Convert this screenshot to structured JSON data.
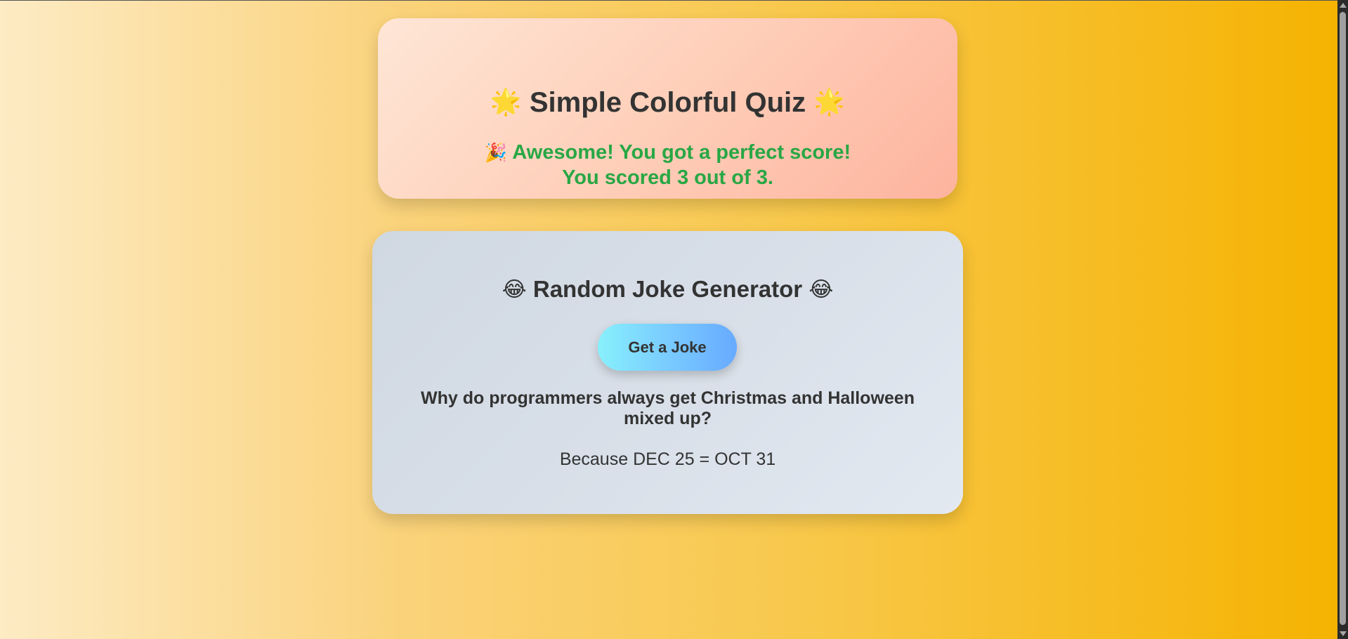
{
  "quiz": {
    "title_emoji_left": "🌟",
    "title": "Simple Colorful Quiz",
    "title_emoji_right": "🌟",
    "result_emoji": "🎉",
    "result_message": "Awesome! You got a perfect score!",
    "score_text": "You scored 3 out of 3.",
    "score": 3,
    "total": 3,
    "result_color": "#28a745"
  },
  "joke": {
    "title_emoji_left": "😂",
    "title": "Random Joke Generator",
    "title_emoji_right": "😂",
    "button_label": "Get a Joke",
    "setup": "Why do programmers always get Christmas and Halloween mixed up?",
    "punchline": "Because DEC 25 = OCT 31"
  },
  "colors": {
    "background_start": "#fdebc4",
    "background_end": "#f5b200",
    "text": "#333333",
    "button_start": "#88f0fc",
    "button_end": "#67aaff"
  }
}
